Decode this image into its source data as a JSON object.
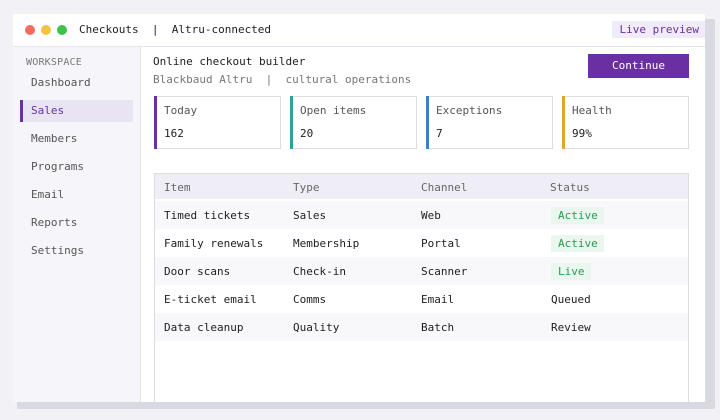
{
  "window": {
    "title": "Checkouts  |  Altru-connected",
    "live_preview": "Live preview"
  },
  "sidebar": {
    "section_label": "WORKSPACE",
    "items": [
      {
        "label": "Dashboard",
        "active": false
      },
      {
        "label": "Sales",
        "active": true
      },
      {
        "label": "Members",
        "active": false
      },
      {
        "label": "Programs",
        "active": false
      },
      {
        "label": "Email",
        "active": false
      },
      {
        "label": "Reports",
        "active": false
      },
      {
        "label": "Settings",
        "active": false
      }
    ]
  },
  "main": {
    "title": "Online checkout builder",
    "subtitle": "Blackbaud Altru  |  cultural operations",
    "continue_label": "Continue"
  },
  "stats": [
    {
      "label": "Today",
      "value": "162",
      "accent": "#6a2fa3"
    },
    {
      "label": "Open items",
      "value": "20",
      "accent": "#2aa39a"
    },
    {
      "label": "Exceptions",
      "value": "7",
      "accent": "#3a7fc8"
    },
    {
      "label": "Health",
      "value": "99%",
      "accent": "#e0a52e"
    }
  ],
  "table": {
    "columns": [
      "Item",
      "Type",
      "Channel",
      "Status"
    ],
    "rows": [
      {
        "item": "Timed tickets",
        "type": "Sales",
        "channel": "Web",
        "status": "Active",
        "status_badge": true
      },
      {
        "item": "Family renewals",
        "type": "Membership",
        "channel": "Portal",
        "status": "Active",
        "status_badge": true
      },
      {
        "item": "Door scans",
        "type": "Check-in",
        "channel": "Scanner",
        "status": "Live",
        "status_badge": true
      },
      {
        "item": "E-ticket email",
        "type": "Comms",
        "channel": "Email",
        "status": "Queued",
        "status_badge": false
      },
      {
        "item": "Data cleanup",
        "type": "Quality",
        "channel": "Batch",
        "status": "Review",
        "status_badge": false
      }
    ]
  },
  "colors": {
    "accent": "#6a2fa3",
    "badge_bg": "#e9f7ef",
    "badge_text": "#2b9a54"
  }
}
